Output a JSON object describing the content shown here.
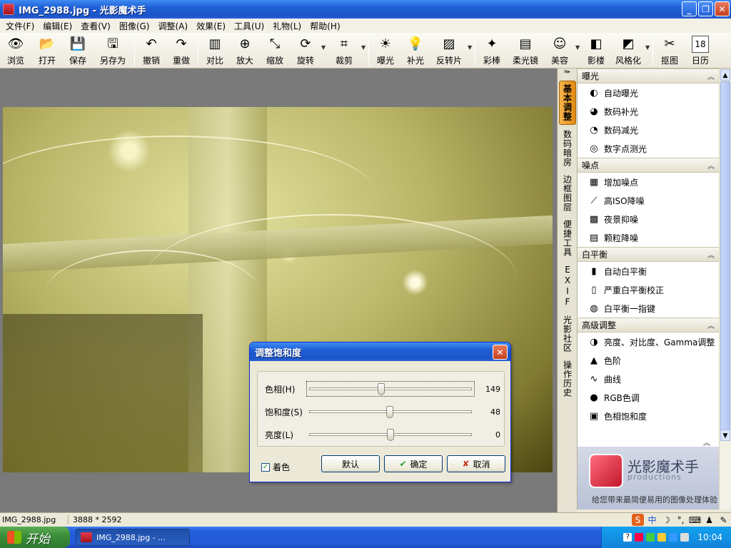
{
  "window": {
    "title": "IMG_2988.jpg - 光影魔术手"
  },
  "menu": [
    "文件(F)",
    "编辑(E)",
    "查看(V)",
    "图像(G)",
    "调整(A)",
    "效果(E)",
    "工具(U)",
    "礼物(L)",
    "帮助(H)"
  ],
  "toolbar": [
    {
      "label": "浏览",
      "icon": "browse-icon"
    },
    {
      "label": "打开",
      "icon": "folder-icon"
    },
    {
      "label": "保存",
      "icon": "save-icon"
    },
    {
      "label": "另存为",
      "icon": "save-as-icon"
    },
    {
      "label": "撤销",
      "icon": "undo-icon"
    },
    {
      "label": "重做",
      "icon": "redo-icon"
    },
    {
      "label": "对比",
      "icon": "compare-icon"
    },
    {
      "label": "放大",
      "icon": "zoom-in-icon"
    },
    {
      "label": "缩放",
      "icon": "resize-icon"
    },
    {
      "label": "旋转",
      "icon": "rotate-icon"
    },
    {
      "label": "裁剪",
      "icon": "crop-icon"
    },
    {
      "label": "曝光",
      "icon": "exposure-icon"
    },
    {
      "label": "补光",
      "icon": "fill-light-icon"
    },
    {
      "label": "反转片",
      "icon": "reversal-film-icon"
    },
    {
      "label": "彩棒",
      "icon": "color-wand-icon"
    },
    {
      "label": "柔光镜",
      "icon": "soft-light-icon"
    },
    {
      "label": "美容",
      "icon": "beauty-icon"
    },
    {
      "label": "影楼",
      "icon": "studio-icon"
    },
    {
      "label": "风格化",
      "icon": "stylize-icon"
    },
    {
      "label": "抠图",
      "icon": "cutout-icon"
    },
    {
      "label": "日历",
      "icon": "calendar-icon"
    }
  ],
  "calendar_day": "18",
  "vtabs": [
    "基本调整",
    "数码暗房",
    "边框图层",
    "便捷工具",
    "EXIF",
    "光影社区",
    "操作历史"
  ],
  "panel": {
    "sections": [
      {
        "title": "曝光",
        "items": [
          {
            "label": "自动曝光",
            "icon": "auto-exposure-icon"
          },
          {
            "label": "数码补光",
            "icon": "digital-fill-light-icon"
          },
          {
            "label": "数码减光",
            "icon": "digital-reduce-light-icon"
          },
          {
            "label": "数字点测光",
            "icon": "spot-metering-icon"
          }
        ]
      },
      {
        "title": "噪点",
        "items": [
          {
            "label": "增加噪点",
            "icon": "add-noise-icon"
          },
          {
            "label": "高ISO降噪",
            "icon": "high-iso-denoise-icon"
          },
          {
            "label": "夜景抑噪",
            "icon": "night-denoise-icon"
          },
          {
            "label": "颗粒降噪",
            "icon": "grain-denoise-icon"
          }
        ]
      },
      {
        "title": "白平衡",
        "items": [
          {
            "label": "自动白平衡",
            "icon": "auto-white-balance-icon"
          },
          {
            "label": "严重白平衡校正",
            "icon": "severe-white-balance-icon"
          },
          {
            "label": "白平衡一指键",
            "icon": "white-balance-picker-icon"
          }
        ]
      },
      {
        "title": "高级调整",
        "items": [
          {
            "label": "亮度、对比度、Gamma调整",
            "icon": "brightness-contrast-icon"
          },
          {
            "label": "色阶",
            "icon": "levels-icon"
          },
          {
            "label": "曲线",
            "icon": "curves-icon"
          },
          {
            "label": "RGB色调",
            "icon": "rgb-tone-icon"
          },
          {
            "label": "色相饱和度",
            "icon": "hue-saturation-icon"
          }
        ]
      }
    ],
    "brand_name": "光影魔术手",
    "brand_sub": "productions",
    "brand_tagline": "给您带来最简便易用的图像处理体验"
  },
  "dialog": {
    "title": "调整饱和度",
    "sliders": [
      {
        "label": "色相(H)",
        "value": "149",
        "fraction": 0.445
      },
      {
        "label": "饱和度(S)",
        "value": "48",
        "fraction": 0.495
      },
      {
        "label": "亮度(L)",
        "value": "0",
        "fraction": 0.5
      }
    ],
    "colorize_label": "着色",
    "colorize_checked": true,
    "buttons": {
      "default": "默认",
      "ok": "确定",
      "cancel": "取消"
    }
  },
  "status": {
    "filename": "IMG_2988.jpg",
    "dimensions": "3888 * 2592"
  },
  "taskbar": {
    "start": "开始",
    "task": "IMG_2988.jpg - ...",
    "clock": "10:04"
  }
}
